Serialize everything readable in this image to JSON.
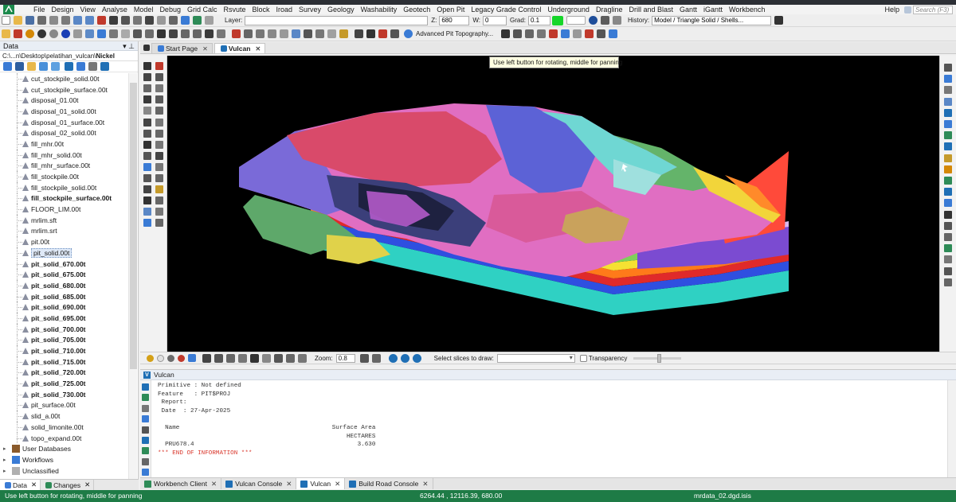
{
  "menus": [
    "File",
    "Design",
    "View",
    "Analyse",
    "Model",
    "Debug",
    "Grid Calc",
    "Rsvute",
    "Block",
    "Iroad",
    "Survey",
    "Geology",
    "Washability",
    "Geotech",
    "Open Pit",
    "Legacy Grade Control",
    "Underground",
    "Dragline",
    "Drill and Blast",
    "Gantt",
    "iGantt",
    "Workbench"
  ],
  "menu_help": "Help",
  "search_placeholder": "Search (F3)",
  "toolbar": {
    "layer_label": "Layer:",
    "z_label": "Z:",
    "z_value": "680",
    "w_label": "W:",
    "w_value": "0",
    "grad_label": "Grad:",
    "grad_value": "0.1",
    "history_label": "History:",
    "history_value": "Model / Triangle Solid / Shells...",
    "adv_pit": "Advanced Pit Topography..."
  },
  "data_panel": {
    "title": "Data",
    "path_prefix": "C:\\...n\\Desktop\\pelatihan_vulcan\\",
    "path_bold": "Nickel",
    "files": [
      {
        "name": "cut_stockpile_solid.00t",
        "bold": false
      },
      {
        "name": "cut_stockpile_surface.00t",
        "bold": false
      },
      {
        "name": "disposal_01.00t",
        "bold": false
      },
      {
        "name": "disposal_01_solid.00t",
        "bold": false
      },
      {
        "name": "disposal_01_surface.00t",
        "bold": false
      },
      {
        "name": "disposal_02_solid.00t",
        "bold": false
      },
      {
        "name": "fill_mhr.00t",
        "bold": false
      },
      {
        "name": "fill_mhr_solid.00t",
        "bold": false
      },
      {
        "name": "fill_mhr_surface.00t",
        "bold": false
      },
      {
        "name": "fill_stockpile.00t",
        "bold": false
      },
      {
        "name": "fill_stockpile_solid.00t",
        "bold": false
      },
      {
        "name": "fill_stockpile_surface.00t",
        "bold": true
      },
      {
        "name": "FLOOR_LIM.00t",
        "bold": false
      },
      {
        "name": "mrlim.sft",
        "bold": false
      },
      {
        "name": "mrlim.srt",
        "bold": false
      },
      {
        "name": "pit.00t",
        "bold": false
      },
      {
        "name": "pit_solid.00t",
        "bold": false,
        "selected": true
      },
      {
        "name": "pit_solid_670.00t",
        "bold": true
      },
      {
        "name": "pit_solid_675.00t",
        "bold": true
      },
      {
        "name": "pit_solid_680.00t",
        "bold": true
      },
      {
        "name": "pit_solid_685.00t",
        "bold": true
      },
      {
        "name": "pit_solid_690.00t",
        "bold": true
      },
      {
        "name": "pit_solid_695.00t",
        "bold": true
      },
      {
        "name": "pit_solid_700.00t",
        "bold": true
      },
      {
        "name": "pit_solid_705.00t",
        "bold": true
      },
      {
        "name": "pit_solid_710.00t",
        "bold": true
      },
      {
        "name": "pit_solid_715.00t",
        "bold": true
      },
      {
        "name": "pit_solid_720.00t",
        "bold": true
      },
      {
        "name": "pit_solid_725.00t",
        "bold": true
      },
      {
        "name": "pit_solid_730.00t",
        "bold": true
      },
      {
        "name": "pit_surface.00t",
        "bold": false
      },
      {
        "name": "slid_a.00t",
        "bold": false
      },
      {
        "name": "solid_limonite.00t",
        "bold": false
      },
      {
        "name": "topo_expand.00t",
        "bold": false
      }
    ],
    "groups": [
      "User Databases",
      "Workflows",
      "Unclassified"
    ],
    "tabs": [
      "Data",
      "Changes"
    ]
  },
  "doc_tabs": [
    "Start Page",
    "Vulcan"
  ],
  "tooltip": "Use left button for rotating, middle for panning",
  "view_toolbar": {
    "zoom_label": "Zoom:",
    "zoom_value": "0.8",
    "slices_label": "Select slices to draw:",
    "transparency_label": "Transparency"
  },
  "console": {
    "title": "Vulcan",
    "lines": [
      "Primitive : Not defined",
      "Feature   : PIT$PROJ",
      " Report:",
      " Date  : 27-Apr-2025",
      "",
      "  Name                                          Surface Area",
      "                                                    HECTARES",
      "  PRU678.4                                             3.630"
    ],
    "end_line": "*** END OF INFORMATION ***"
  },
  "console_tabs": [
    "Workbench Client",
    "Vulcan Console",
    "Vulcan",
    "Build Road Console"
  ],
  "status": {
    "left": "Use left button for rotating, middle for panning",
    "coords": "6264.44 , 12116.39, 680.00",
    "file": "mrdata_02.dgd.isis"
  },
  "colors": {
    "status_green": "#1e7b46",
    "viewport_bg": "#000000",
    "grad_swatch": "#16d62a"
  }
}
